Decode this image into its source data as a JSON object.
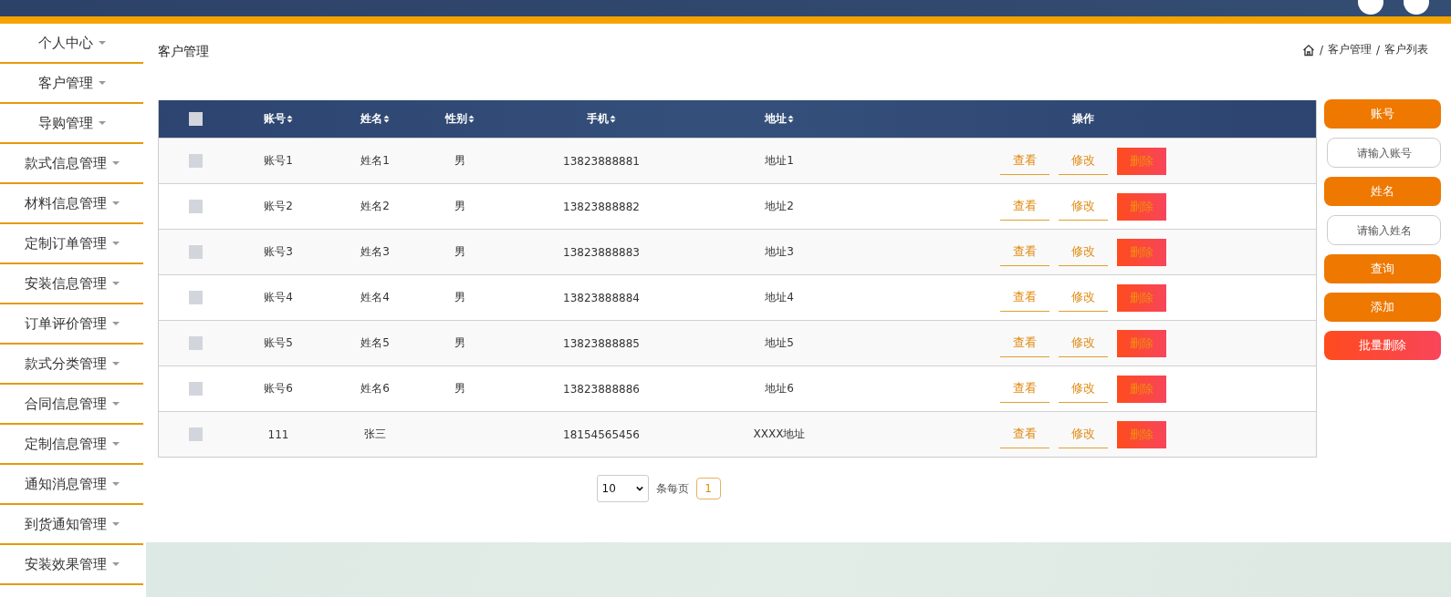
{
  "sidebar": {
    "items": [
      {
        "label": "个人中心"
      },
      {
        "label": "客户管理"
      },
      {
        "label": "导购管理"
      },
      {
        "label": "款式信息管理"
      },
      {
        "label": "材料信息管理"
      },
      {
        "label": "定制订单管理"
      },
      {
        "label": "安装信息管理"
      },
      {
        "label": "订单评价管理"
      },
      {
        "label": "款式分类管理"
      },
      {
        "label": "合同信息管理"
      },
      {
        "label": "定制信息管理"
      },
      {
        "label": "通知消息管理"
      },
      {
        "label": "到货通知管理"
      },
      {
        "label": "安装效果管理"
      }
    ]
  },
  "page_title": "客户管理",
  "breadcrumb": [
    {
      "separator": "/",
      "label": "客户管理"
    },
    {
      "separator": "/",
      "label": "客户列表"
    }
  ],
  "table": {
    "select_all": {
      "checked": false
    },
    "columns": [
      {
        "label": "账号",
        "sortable": true
      },
      {
        "label": "姓名",
        "sortable": true
      },
      {
        "label": "性别",
        "sortable": true
      },
      {
        "label": "手机",
        "sortable": true
      },
      {
        "label": "地址",
        "sortable": true
      },
      {
        "label": "操作",
        "sortable": false
      }
    ],
    "rows": [
      {
        "checked": false,
        "cells": [
          "账号1",
          "姓名1",
          "男",
          "13823888881",
          "地址1"
        ],
        "actions": [
          {
            "label": "查看",
            "kind": "link"
          },
          {
            "label": "修改",
            "kind": "link"
          },
          {
            "label": "删除",
            "kind": "danger"
          }
        ]
      },
      {
        "checked": false,
        "cells": [
          "账号2",
          "姓名2",
          "男",
          "13823888882",
          "地址2"
        ],
        "actions": [
          {
            "label": "查看",
            "kind": "link"
          },
          {
            "label": "修改",
            "kind": "link"
          },
          {
            "label": "删除",
            "kind": "danger"
          }
        ]
      },
      {
        "checked": false,
        "cells": [
          "账号3",
          "姓名3",
          "男",
          "13823888883",
          "地址3"
        ],
        "actions": [
          {
            "label": "查看",
            "kind": "link"
          },
          {
            "label": "修改",
            "kind": "link"
          },
          {
            "label": "删除",
            "kind": "danger"
          }
        ]
      },
      {
        "checked": false,
        "cells": [
          "账号4",
          "姓名4",
          "男",
          "13823888884",
          "地址4"
        ],
        "actions": [
          {
            "label": "查看",
            "kind": "link"
          },
          {
            "label": "修改",
            "kind": "link"
          },
          {
            "label": "删除",
            "kind": "danger"
          }
        ]
      },
      {
        "checked": false,
        "cells": [
          "账号5",
          "姓名5",
          "男",
          "13823888885",
          "地址5"
        ],
        "actions": [
          {
            "label": "查看",
            "kind": "link"
          },
          {
            "label": "修改",
            "kind": "link"
          },
          {
            "label": "删除",
            "kind": "danger"
          }
        ]
      },
      {
        "checked": false,
        "cells": [
          "账号6",
          "姓名6",
          "男",
          "13823888886",
          "地址6"
        ],
        "actions": [
          {
            "label": "查看",
            "kind": "link"
          },
          {
            "label": "修改",
            "kind": "link"
          },
          {
            "label": "删除",
            "kind": "danger"
          }
        ]
      },
      {
        "checked": false,
        "cells": [
          "111",
          "张三",
          null,
          "18154565456",
          "XXXX地址"
        ],
        "actions": [
          {
            "label": "查看",
            "kind": "link"
          },
          {
            "label": "修改",
            "kind": "link"
          },
          {
            "label": "删除",
            "kind": "danger"
          }
        ]
      }
    ]
  },
  "search": {
    "fields": [
      {
        "label": "账号",
        "placeholder": "请输入账号"
      },
      {
        "label": "姓名",
        "placeholder": "请输入姓名"
      }
    ],
    "buttons": [
      {
        "label": "查询",
        "kind": "primary"
      },
      {
        "label": "添加",
        "kind": "primary"
      },
      {
        "label": "批量删除",
        "kind": "danger"
      }
    ]
  },
  "pagination": {
    "page_size": "10",
    "per_page_label": "条每页",
    "pages": [
      {
        "label": "1",
        "selected": true
      }
    ]
  }
}
